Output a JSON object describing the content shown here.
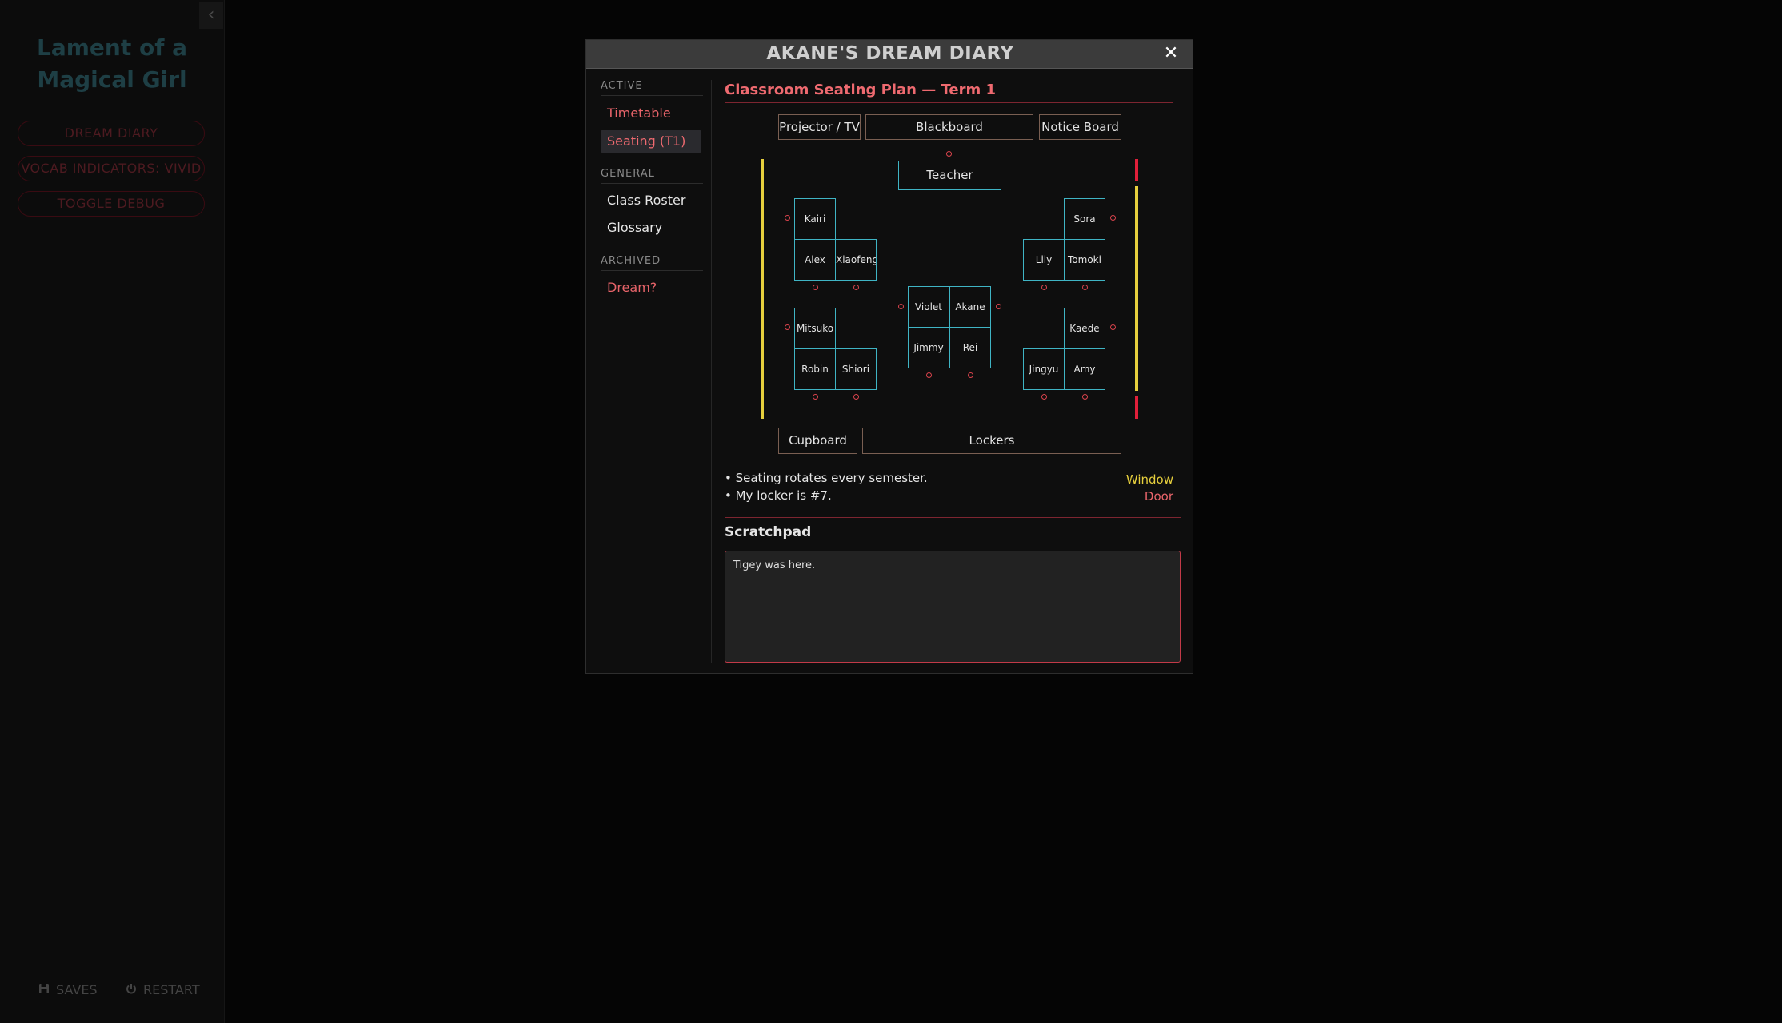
{
  "sidebar": {
    "collapse_icon": "‹",
    "story_title": "Lament of a Magical Girl",
    "buttons": [
      "DREAM DIARY",
      "VOCAB INDICATORS: VIVID",
      "TOGGLE DEBUG"
    ],
    "menu": {
      "saves": "SAVES",
      "restart": "RESTART"
    }
  },
  "dialog": {
    "title": "AKANE'S DREAM DIARY",
    "close_icon": "✕",
    "nav": {
      "active_head": "ACTIVE",
      "timetable": "Timetable",
      "seating": "Seating (T1)",
      "general_head": "GENERAL",
      "class_roster": "Class Roster",
      "glossary": "Glossary",
      "archived_head": "ARCHIVED",
      "dream": "Dream?"
    },
    "content": {
      "title": "Classroom Seating Plan — Term 1",
      "front": {
        "projector": "Projector / TV",
        "blackboard": "Blackboard",
        "notice_board": "Notice Board"
      },
      "teacher": "Teacher",
      "students": {
        "kairi": "Kairi",
        "alex": "Alex",
        "xiaofeng": "Xiaofeng",
        "sora": "Sora",
        "lily": "Lily",
        "tomoki": "Tomoki",
        "violet": "Violet",
        "akane": "Akane",
        "jimmy": "Jimmy",
        "rei": "Rei",
        "mitsuko": "Mitsuko",
        "robin": "Robin",
        "shiori": "Shiori",
        "kaede": "Kaede",
        "jingyu": "Jingyu",
        "amy": "Amy"
      },
      "back": {
        "cupboard": "Cupboard",
        "lockers": "Lockers"
      },
      "notes": [
        "• Seating rotates every semester.",
        "• My locker is #7."
      ],
      "legend": {
        "window": "Window",
        "door": "Door"
      },
      "colors": {
        "window": "#e6cf3d",
        "door": "#e01f3a",
        "desk": "#3fb4c4",
        "chair": "#d9434c",
        "accent": "#ef6a70"
      },
      "scratchpad_title": "Scratchpad",
      "scratchpad_value": "Tigey was here."
    }
  }
}
